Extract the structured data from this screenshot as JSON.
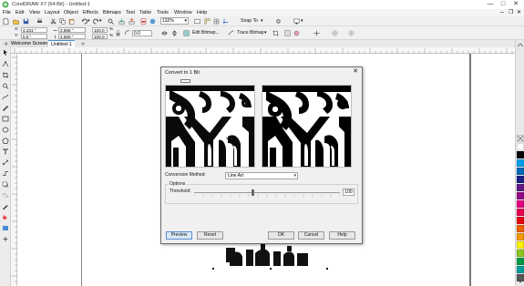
{
  "window": {
    "title": "CorelDRAW X7 (64-Bit) - Untitled-1",
    "controls": [
      "—",
      "□",
      "✕"
    ]
  },
  "menu": [
    "File",
    "Edit",
    "View",
    "Layout",
    "Object",
    "Effects",
    "Bitmaps",
    "Text",
    "Table",
    "Tools",
    "Window",
    "Help"
  ],
  "toolbar": {
    "zoom_value": "132%",
    "snap_to_label": "Snap To"
  },
  "propbar": {
    "x_label": "X:",
    "x_value": "4.231 \"",
    "y_label": "Y:",
    "y_value": "5.5 \"",
    "w_value": "2.888 \"",
    "h_value": "4.659 \"",
    "scale_w": "100.0",
    "scale_h": "100.0",
    "percent": "%",
    "angle_value": "0.0",
    "edit_bitmap_label": "Edit Bitmap...",
    "trace_bitmap_label": "Trace Bitmap"
  },
  "tabs": [
    "Welcome Screen",
    "Untitled-1"
  ],
  "tools": [
    "pick-tool-icon",
    "shape-tool-icon",
    "crop-tool-icon",
    "zoom-tool-icon",
    "freehand-tool-icon",
    "artistic-media-icon",
    "rectangle-tool-icon",
    "ellipse-tool-icon",
    "polygon-tool-icon",
    "text-tool-icon",
    "parallel-dimension-icon",
    "connector-tool-icon",
    "drop-shadow-icon",
    "transparency-tool-icon",
    "eyedropper-tool-icon",
    "interactive-fill-icon",
    "smart-fill-icon",
    "add-tool-icon"
  ],
  "palette": {
    "colors": [
      "#ffffff",
      "#000000",
      "#00a0e9",
      "#0068b7",
      "#1d2088",
      "#601986",
      "#920783",
      "#e4007f",
      "#e5004f",
      "#e60012",
      "#eb6100",
      "#f39800",
      "#fff100",
      "#8fc31f",
      "#009944",
      "#009e96",
      "#595757",
      "#c9caca"
    ]
  },
  "dialog": {
    "title": "Convert to 1 Bit",
    "close_label": "✕",
    "conversion_method_label": "Conversion Method:",
    "conversion_method_value": "Line Art",
    "options_label": "Options",
    "threshold_label": "Threshold:",
    "threshold_value": "100",
    "threshold_fraction": 0.4,
    "buttons": {
      "preview": "Preview",
      "reset": "Reset",
      "ok": "OK",
      "cancel": "Cancel",
      "help": "Help"
    }
  }
}
